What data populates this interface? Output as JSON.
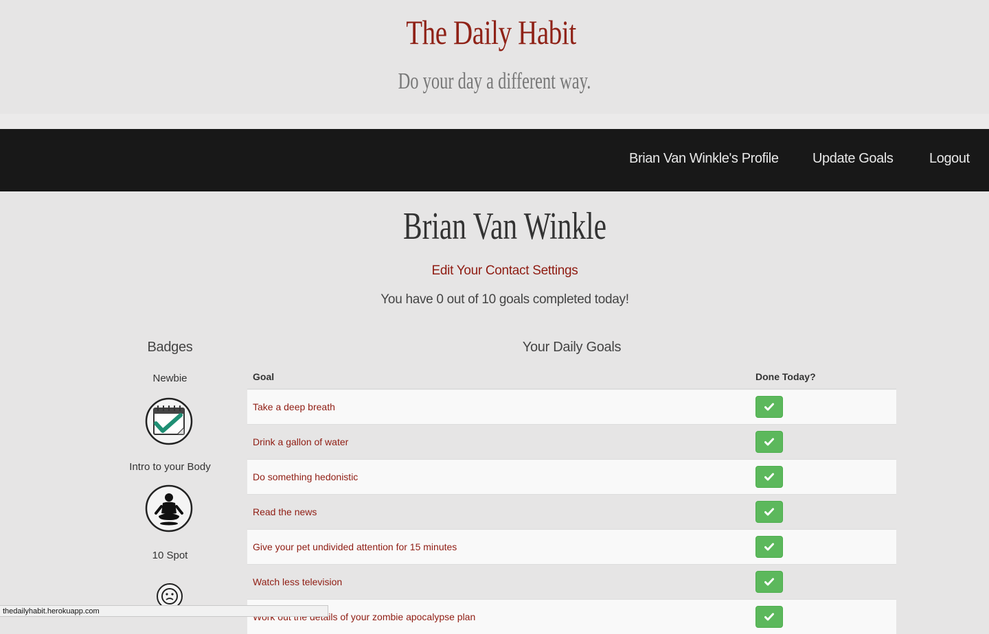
{
  "header": {
    "brand_title": "The Daily Habit",
    "tagline": "Do your day a different way."
  },
  "nav": {
    "profile_link": "Brian Van Winkle's Profile",
    "update_goals": "Update Goals",
    "logout": "Logout"
  },
  "profile": {
    "name": "Brian Van Winkle",
    "edit_settings": "Edit Your Contact Settings",
    "progress_text": "You have 0 out of 10 goals completed today!"
  },
  "badges": {
    "heading": "Badges",
    "items": [
      {
        "name": "Newbie",
        "icon": "calendar-check-icon"
      },
      {
        "name": "Intro to your Body",
        "icon": "meditation-figure-icon"
      },
      {
        "name": "10 Spot",
        "icon": "sad-face-icon"
      }
    ]
  },
  "goals": {
    "heading": "Your Daily Goals",
    "col_goal": "Goal",
    "col_done": "Done Today?",
    "rows": [
      {
        "goal": "Take a deep breath"
      },
      {
        "goal": "Drink a gallon of water"
      },
      {
        "goal": "Do something hedonistic"
      },
      {
        "goal": "Read the news"
      },
      {
        "goal": "Give your pet undivided attention for 15 minutes"
      },
      {
        "goal": "Watch less television"
      },
      {
        "goal": "Work out the details of your zombie apocalypse plan"
      }
    ]
  },
  "status_bar": {
    "url": "thedailyhabit.herokuapp.com"
  },
  "colors": {
    "brand": "#8f2217",
    "link": "#8f1c12",
    "navbar": "#181818",
    "success": "#5cb85c",
    "background": "#e6e5e5"
  }
}
